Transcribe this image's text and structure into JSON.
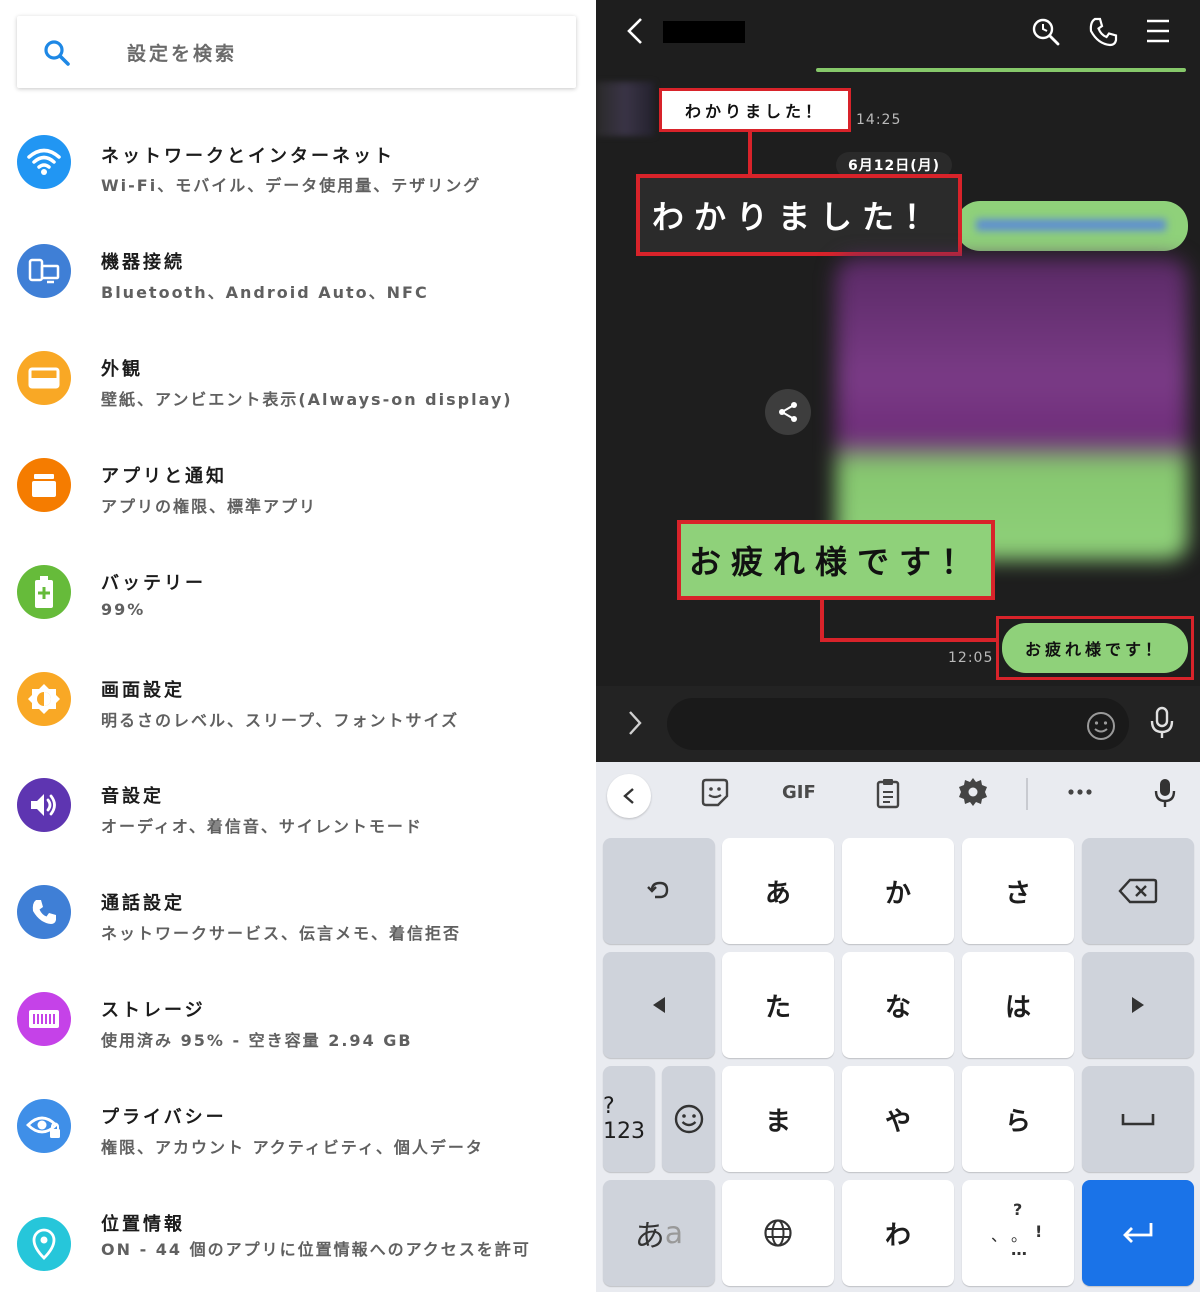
{
  "settings": {
    "search_placeholder": "設定を検索",
    "items": [
      {
        "title": "ネットワークとインターネット",
        "subtitle": "Wi-Fi、モバイル、データ使用量、テザリング",
        "icon": "wifi-icon",
        "color": "#2196f3"
      },
      {
        "title": "機器接続",
        "subtitle": "Bluetooth、Android Auto、NFC",
        "icon": "devices-icon",
        "color": "#3f7fd6"
      },
      {
        "title": "外観",
        "subtitle": "壁紙、アンビエント表示(Always-on display)",
        "icon": "wallpaper-icon",
        "color": "#f9a825"
      },
      {
        "title": "アプリと通知",
        "subtitle": "アプリの権限、標準アプリ",
        "icon": "apps-icon",
        "color": "#f57c00"
      },
      {
        "title": "バッテリー",
        "subtitle": "99%",
        "icon": "battery-icon",
        "color": "#66bb3a"
      },
      {
        "title": "画面設定",
        "subtitle": "明るさのレベル、スリープ、フォントサイズ",
        "icon": "brightness-icon",
        "color": "#f9a825"
      },
      {
        "title": "音設定",
        "subtitle": "オーディオ、着信音、サイレントモード",
        "icon": "volume-icon",
        "color": "#5e35b1"
      },
      {
        "title": "通話設定",
        "subtitle": "ネットワークサービス、伝言メモ、着信拒否",
        "icon": "phone-icon",
        "color": "#3f7fd6"
      },
      {
        "title": "ストレージ",
        "subtitle": "使用済み 95% - 空き容量 2.94 GB",
        "icon": "storage-icon",
        "color": "#c542e8"
      },
      {
        "title": "プライバシー",
        "subtitle": "権限、アカウント アクティビティ、個人データ",
        "icon": "privacy-icon",
        "color": "#3f8fe8"
      },
      {
        "title": "位置情報",
        "subtitle": "ON - 44 個のアプリに位置情報へのアクセスを許可",
        "icon": "location-icon",
        "color": "#26c6da"
      }
    ]
  },
  "chat": {
    "messages": {
      "received_text": "わかりました！",
      "received_time": "14:25",
      "date_separator": "6月12日(月)",
      "zoom_received": "わかりました！",
      "zoom_sent": "お疲れ様です！",
      "sent_text": "お疲れ様です！",
      "sent_time": "12:05"
    }
  },
  "keyboard": {
    "toolbar": {
      "gif_label": "GIF"
    },
    "keys": {
      "a": "あ",
      "ka": "か",
      "sa": "さ",
      "ta": "た",
      "na": "な",
      "ha": "は",
      "ma": "ま",
      "ya": "や",
      "ra": "ら",
      "wa": "わ",
      "numbers": "?123",
      "kana_mode_1": "あ",
      "kana_mode_2": "a",
      "punct_q": "?",
      "punct_ex": "!",
      "punct_dots": "…"
    }
  },
  "colors": {
    "highlight": "#d8232a",
    "chat_bubble": "#8fd17a",
    "enter_key": "#1a73e8",
    "chat_bg": "#1e1e1e"
  }
}
